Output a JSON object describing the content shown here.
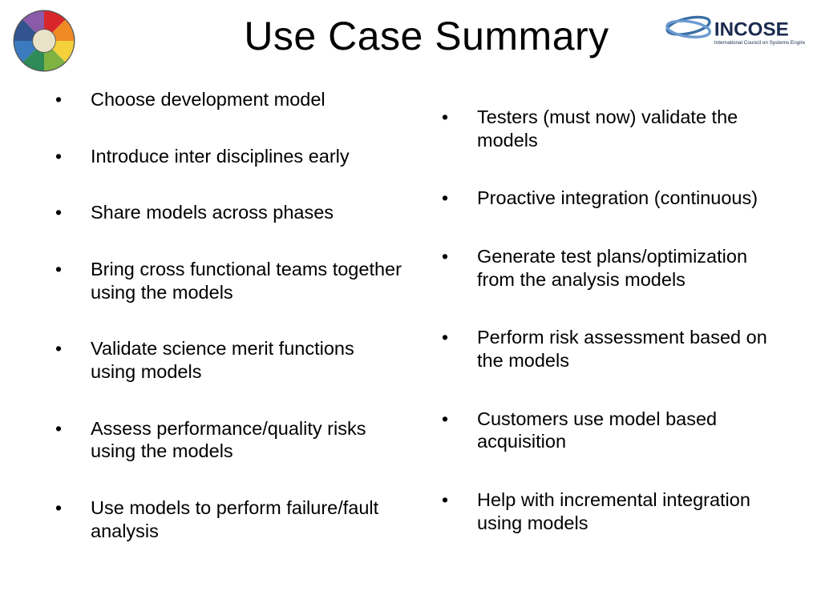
{
  "title": "Use Case Summary",
  "logo_left_name": "color-wheel-icon",
  "logo_right_name": "incose-logo",
  "logo_right_text": "INCOSE",
  "logo_right_sub": "International Council on Systems Engineering",
  "left_bullets": [
    "Choose development model",
    "Introduce inter disciplines early",
    "Share models across phases",
    "Bring cross functional teams together using the models",
    "Validate science merit functions using models",
    "Assess performance/quality risks using the models",
    "Use models to perform failure/fault analysis"
  ],
  "right_bullets": [
    "Testers (must now) validate the models",
    "Proactive integration (continuous)",
    "Generate test plans/optimization from the analysis models",
    "Perform risk assessment based on the models",
    "Customers use model based acquisition",
    "Help with incremental integration using models"
  ]
}
